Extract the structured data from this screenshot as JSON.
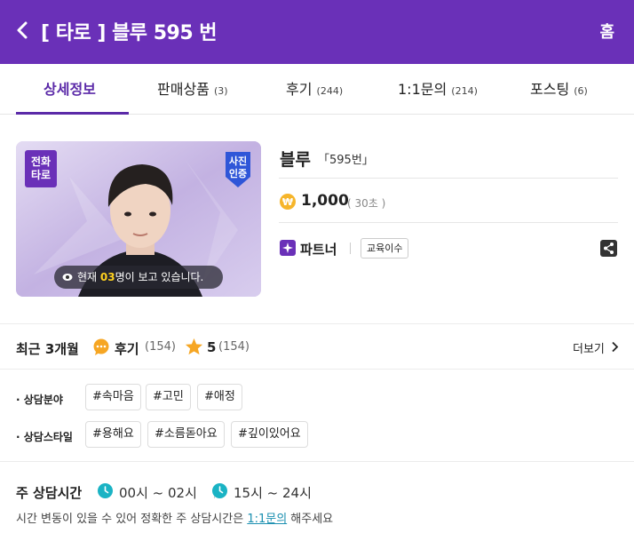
{
  "header": {
    "title": "[ 타로 ] 블루 595 번",
    "home_label": "홈"
  },
  "tabs": [
    {
      "label": "상세정보",
      "count": ""
    },
    {
      "label": "판매상품",
      "count": "(3)"
    },
    {
      "label": "후기",
      "count": "(244)"
    },
    {
      "label": "1:1문의",
      "count": "(214)"
    },
    {
      "label": "포스팅",
      "count": "(6)"
    }
  ],
  "profile": {
    "call_badge": "전화\n타로",
    "verify_badge": "사진\n인증",
    "viewers_prefix": "현재 ",
    "viewers_count": "03",
    "viewers_suffix": "명이 보고 있습니다.",
    "name": "블루",
    "number": "「595번」",
    "price": "1,000",
    "per": "( 30초 )",
    "partner_label": "파트너",
    "edu_badge": "교육이수"
  },
  "review": {
    "period_label": "최근 3개월",
    "review_word": "후기",
    "review_count": "(154)",
    "rating": "5",
    "rating_count": "(154)",
    "more_label": "더보기"
  },
  "tags": {
    "field_label": "· 상담분야",
    "field_tags": [
      "#속마음",
      "#고민",
      "#애정"
    ],
    "style_label": "· 상담스타일",
    "style_tags": [
      "#용해요",
      "#소름돋아요",
      "#깊이있어요"
    ]
  },
  "hours": {
    "title": "주 상담시간",
    "slot1": "00시 ~ 02시",
    "slot2": "15시 ~ 24시",
    "note_prefix": "시간 변동이 있을 수 있어 정확한 주 상담시간은 ",
    "note_link": "1:1문의",
    "note_suffix": " 해주세요"
  },
  "colors": {
    "brand_purple": "#6a30b8",
    "tab_active": "#5b2aa8",
    "viewer_highlight": "#ffd21f",
    "clock_teal": "#1ab3c4",
    "star_orange": "#f6a623",
    "link": "#1a8fb0"
  },
  "icons": [
    "back-arrow-icon",
    "eye-icon",
    "coin-icon",
    "partner-star-icon",
    "share-icon",
    "speech-bubble-icon",
    "star-icon",
    "chevron-right-icon",
    "clock-icon"
  ]
}
